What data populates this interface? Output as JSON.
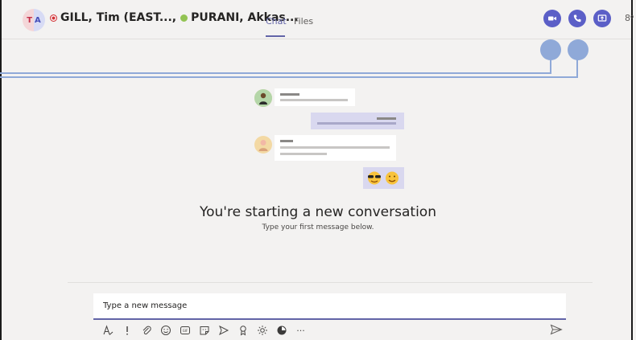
{
  "header": {
    "avatar_initials": [
      "T",
      "A"
    ],
    "participants": [
      {
        "name": "GILL, Tim (EAST...,",
        "status": "busy",
        "status_color": "#d13438"
      },
      {
        "name": "PURANI, Akkas...",
        "status": "available",
        "status_color": "#92c353"
      }
    ],
    "tabs": [
      {
        "label": "Chat",
        "active": true
      },
      {
        "label": "Files",
        "active": false
      }
    ],
    "actions": [
      {
        "name": "video-call",
        "icon": "video-camera-icon"
      },
      {
        "name": "audio-call",
        "icon": "phone-icon"
      },
      {
        "name": "share-screen",
        "icon": "share-screen-icon"
      }
    ],
    "overflow_glyph": "8ᵒ"
  },
  "empty_state": {
    "title": "You're starting a new conversation",
    "subtitle": "Type your first message below."
  },
  "composer": {
    "placeholder": "Type a new message",
    "tools": [
      "format-icon",
      "important-icon",
      "attach-icon",
      "emoji-icon",
      "gif-icon",
      "sticker-icon",
      "meet-now-icon",
      "praise-icon",
      "stream-icon",
      "app-icon",
      "more-options-icon"
    ],
    "more_label": "···"
  },
  "colors": {
    "accent": "#6264a7",
    "action_button": "#5b5fc7",
    "callout": "#8fa9d8",
    "background": "#f3f2f1"
  }
}
